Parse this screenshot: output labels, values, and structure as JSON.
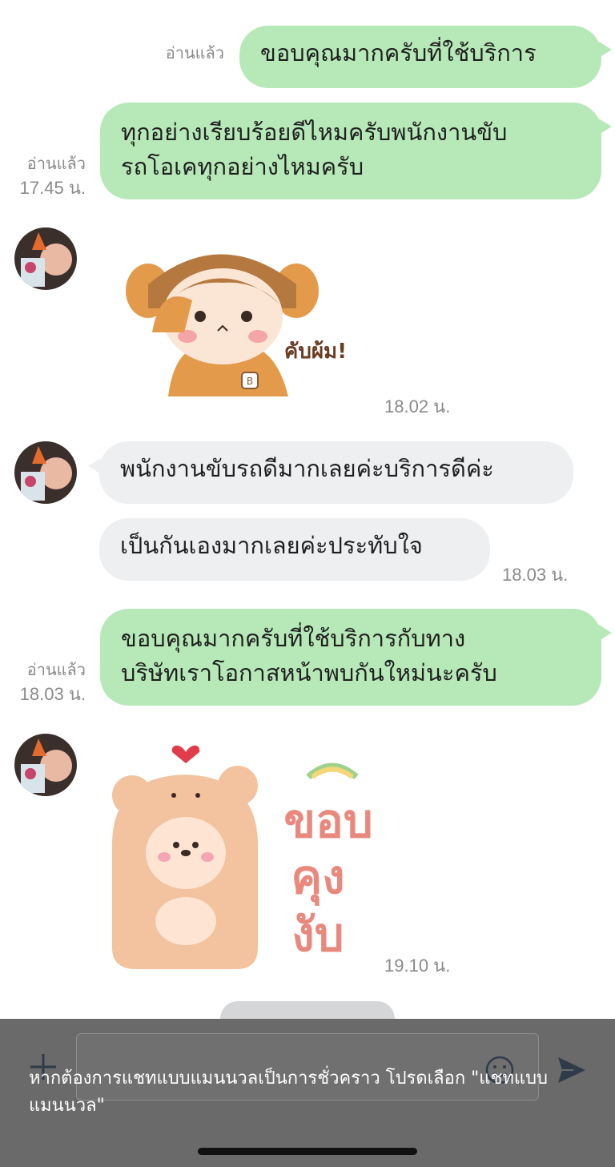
{
  "messages": {
    "m1": {
      "text": "ขอบคุณมากครับที่ใช้บริการ",
      "read": "อ่านแล้ว"
    },
    "m2": {
      "line1": "ทุกอย่างเรียบร้อยดีไหมครับพนักงานขับ",
      "line2": "รถโอเคทุกอย่างไหมครับ",
      "read": "อ่านแล้ว",
      "time": "17.45 น."
    },
    "s1": {
      "time": "18.02 น.",
      "sticker_text": "คับผ้ม!"
    },
    "m3": {
      "text": "พนักงานขับรถดีมากเลยค่ะบริการดีค่ะ"
    },
    "m4": {
      "text": "เป็นกันเองมากเลยค่ะประทับใจ",
      "time": "18.03 น."
    },
    "m5": {
      "line1": "ขอบคุณมากครับที่ใช้บริการกับทาง",
      "line2": "บริษัทเราโอกาสหน้าพบกันใหม่นะครับ",
      "read": "อ่านแล้ว",
      "time": "18.03 น."
    },
    "s2": {
      "time": "19.10 น.",
      "sticker_text": [
        "ขอบ",
        "คุง",
        "งับ"
      ]
    }
  },
  "notice": {
    "line1": "หากต้องการแชทแบบแมนนวลเป็นการชั่วคราว โปรดเลือก \"แชทแบบ",
    "line2": "แมนนวล\""
  },
  "colors": {
    "outgoing": "#b7e9b8",
    "incoming": "#eeeff1",
    "meta": "#8a8a8a",
    "overlay": "#6a6a6a"
  },
  "icons": [
    "plus-icon",
    "emoji-icon",
    "send-icon"
  ]
}
